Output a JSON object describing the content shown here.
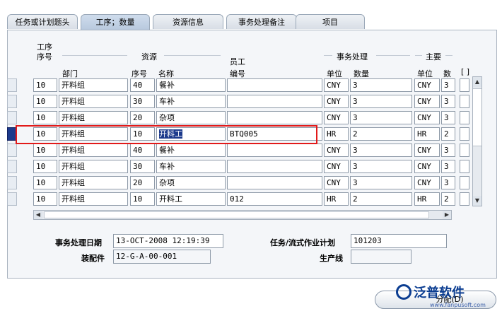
{
  "tabs": [
    {
      "label": "任务或计划题头",
      "active": false
    },
    {
      "label": "工序；数量",
      "active": true
    },
    {
      "label": "资源信息",
      "active": false
    },
    {
      "label": "事务处理备注",
      "active": false
    },
    {
      "label": "项目",
      "active": false
    }
  ],
  "headers": {
    "op_seq_top": "工序",
    "op_seq_bottom": "序号",
    "resource_group": "资源",
    "employee_top": "员工",
    "employee_bottom": "编号",
    "txn_group": "事务处理",
    "primary_group": "主要",
    "department": "部门",
    "res_seq": "序号",
    "name": "名称",
    "txn_unit": "单位",
    "txn_qty": "数量",
    "primary_unit": "单位",
    "primary_qty": "数",
    "flex": "[ ]"
  },
  "rows": [
    {
      "op_seq": "10",
      "dept": "开料组",
      "res_seq": "40",
      "name": "餐补",
      "emp": "",
      "txn_unit": "CNY",
      "txn_qty": "3",
      "pri_unit": "CNY",
      "pri_qty": "3",
      "selected": false
    },
    {
      "op_seq": "10",
      "dept": "开料组",
      "res_seq": "30",
      "name": "车补",
      "emp": "",
      "txn_unit": "CNY",
      "txn_qty": "3",
      "pri_unit": "CNY",
      "pri_qty": "3",
      "selected": false
    },
    {
      "op_seq": "10",
      "dept": "开料组",
      "res_seq": "20",
      "name": "杂项",
      "emp": "",
      "txn_unit": "CNY",
      "txn_qty": "3",
      "pri_unit": "CNY",
      "pri_qty": "3",
      "selected": false
    },
    {
      "op_seq": "10",
      "dept": "开料组",
      "res_seq": "10",
      "name": "开料工",
      "emp": "BTQ005",
      "txn_unit": "HR",
      "txn_qty": "2",
      "pri_unit": "HR",
      "pri_qty": "2",
      "selected": true
    },
    {
      "op_seq": "10",
      "dept": "开料组",
      "res_seq": "40",
      "name": "餐补",
      "emp": "",
      "txn_unit": "CNY",
      "txn_qty": "3",
      "pri_unit": "CNY",
      "pri_qty": "3",
      "selected": false
    },
    {
      "op_seq": "10",
      "dept": "开料组",
      "res_seq": "30",
      "name": "车补",
      "emp": "",
      "txn_unit": "CNY",
      "txn_qty": "3",
      "pri_unit": "CNY",
      "pri_qty": "3",
      "selected": false
    },
    {
      "op_seq": "10",
      "dept": "开料组",
      "res_seq": "20",
      "name": "杂项",
      "emp": "",
      "txn_unit": "CNY",
      "txn_qty": "3",
      "pri_unit": "CNY",
      "pri_qty": "3",
      "selected": false
    },
    {
      "op_seq": "10",
      "dept": "开料组",
      "res_seq": "10",
      "name": "开料工",
      "emp": "012",
      "txn_unit": "HR",
      "txn_qty": "2",
      "pri_unit": "HR",
      "pri_qty": "2",
      "selected": false
    }
  ],
  "footer": {
    "txn_date_label": "事务处理日期",
    "txn_date_value": "13-OCT-2008 12:19:39",
    "assembly_label": "装配件",
    "assembly_value": "12-G-A-00-001",
    "job_label": "任务/流式作业计划",
    "job_value": "101203",
    "line_label": "生产线",
    "line_value": ""
  },
  "allocate_button": "分配(D)",
  "watermark": {
    "text": "泛普软件",
    "url": "www.fanpusoft.com"
  }
}
